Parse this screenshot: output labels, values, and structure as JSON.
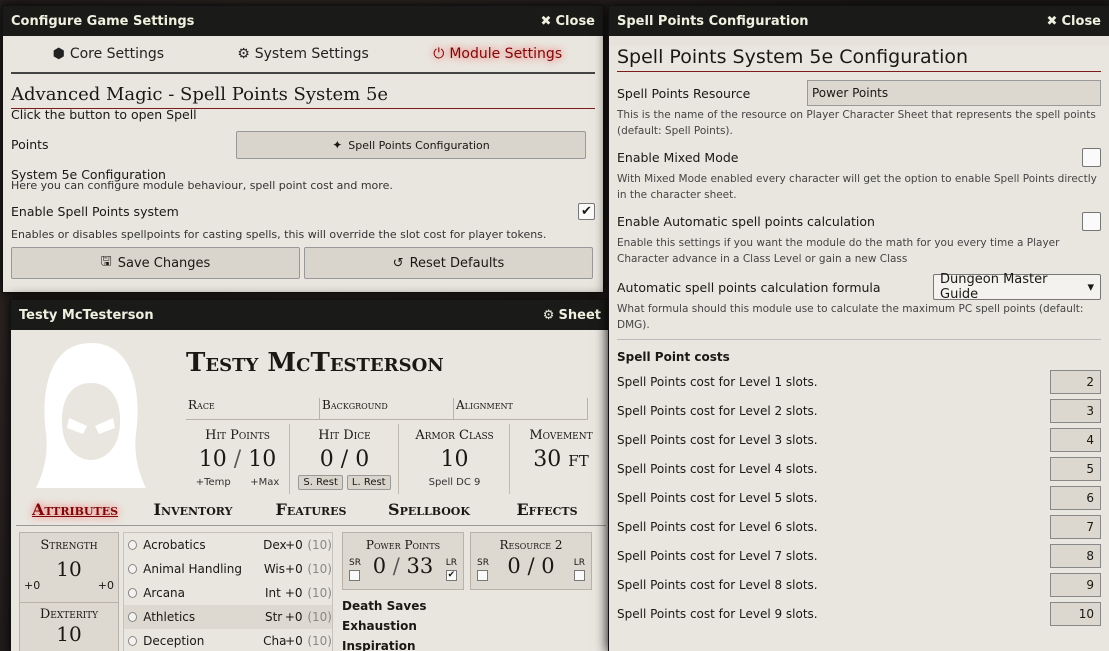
{
  "config_window": {
    "title": "Configure Game Settings",
    "close_label": "Close",
    "tabs": [
      {
        "icon": "d20-icon",
        "label": "Core Settings"
      },
      {
        "icon": "gears-icon",
        "label": "System Settings"
      },
      {
        "icon": "plug-icon",
        "label": "Module Settings"
      }
    ],
    "module_title": "Advanced Magic - Spell Points System 5e",
    "open_label_1": "Click the button to open Spell Points",
    "open_label_2": "System 5e Configuration",
    "open_button": "Spell Points Configuration",
    "open_hint": "Here you can configure module behaviour, spell point cost and more.",
    "enable_label": "Enable Spell Points system",
    "enable_hint": "Enables or disables spellpoints for casting spells, this will override the slot cost for player tokens.",
    "save_label": "Save Changes",
    "reset_label": "Reset Defaults"
  },
  "sheet_window": {
    "title": "Testy McTesterson",
    "sheet_label": "Sheet",
    "name": "Testy McTesterson",
    "info": [
      "Race",
      "Background",
      "Alignment"
    ],
    "hp_label": "Hit Points",
    "hp_value": "10",
    "hp_sep": "/",
    "hp_max": "10",
    "hp_temp": "+Temp",
    "hp_maxlbl": "+Max",
    "hd_label": "Hit Dice",
    "hd_value": "0 / 0",
    "short_rest": "S. Rest",
    "long_rest": "L. Rest",
    "ac_label": "Armor Class",
    "ac_value": "10",
    "spell_dc": "Spell DC 9",
    "move_label": "Movement",
    "move_value": "30 ft",
    "tabs": [
      "Attributes",
      "Inventory",
      "Features",
      "Spellbook",
      "Effects"
    ],
    "str_label": "Strength",
    "str_value": "10",
    "str_mod": "+0",
    "str_save": "+0",
    "dex_label": "Dexterity",
    "dex_value": "10",
    "skills": [
      {
        "name": "Acrobatics",
        "ability": "Dex",
        "mod": "+0",
        "passive": "(10)"
      },
      {
        "name": "Animal Handling",
        "ability": "Wis",
        "mod": "+0",
        "passive": "(10)"
      },
      {
        "name": "Arcana",
        "ability": "Int",
        "mod": "+0",
        "passive": "(10)"
      },
      {
        "name": "Athletics",
        "ability": "Str",
        "mod": "+0",
        "passive": "(10)"
      },
      {
        "name": "Deception",
        "ability": "Cha",
        "mod": "+0",
        "passive": "(10)"
      }
    ],
    "res1_label": "Power Points",
    "res1_value": "0",
    "res1_sep": "/",
    "res1_max": "33",
    "res2_label": "Resource 2",
    "res2_value": "0 / 0",
    "sr": "SR",
    "lr": "LR",
    "death_saves": "Death Saves",
    "exhaustion": "Exhaustion",
    "inspiration": "Inspiration"
  },
  "sp_window": {
    "title": "Spell Points Configuration",
    "close_label": "Close",
    "heading": "Spell Points System 5e Configuration",
    "resource_label": "Spell Points Resource",
    "resource_value": "Power Points",
    "resource_hint": "This is the name of the resource on Player Character Sheet that represents the spell points (default: Spell Points).",
    "mixed_label": "Enable Mixed Mode",
    "mixed_hint": "With Mixed Mode enabled every character will get the option to enable Spell Points directly in the character sheet.",
    "auto_label": "Enable Automatic spell points calculation",
    "auto_hint": "Enable this settings if you want the module do the math for you every time a Player Character advance in a Class Level or gain a new Class",
    "formula_label": "Automatic spell points calculation formula",
    "formula_value": "Dungeon Master Guide",
    "formula_hint": "What formula should this module use to calculate the maximum PC spell points (default: DMG).",
    "costs_heading": "Spell Point costs",
    "costs": [
      {
        "label": "Spell Points cost for Level 1 slots.",
        "value": "2"
      },
      {
        "label": "Spell Points cost for Level 2 slots.",
        "value": "3"
      },
      {
        "label": "Spell Points cost for Level 3 slots.",
        "value": "4"
      },
      {
        "label": "Spell Points cost for Level 4 slots.",
        "value": "5"
      },
      {
        "label": "Spell Points cost for Level 5 slots.",
        "value": "6"
      },
      {
        "label": "Spell Points cost for Level 6 slots.",
        "value": "7"
      },
      {
        "label": "Spell Points cost for Level 7 slots.",
        "value": "8"
      },
      {
        "label": "Spell Points cost for Level 8 slots.",
        "value": "9"
      },
      {
        "label": "Spell Points cost for Level 9 slots.",
        "value": "10"
      }
    ]
  },
  "colors": {
    "accent": "#7a0a0a",
    "header": "#1a1a18",
    "parchment": "#e9e6df"
  }
}
